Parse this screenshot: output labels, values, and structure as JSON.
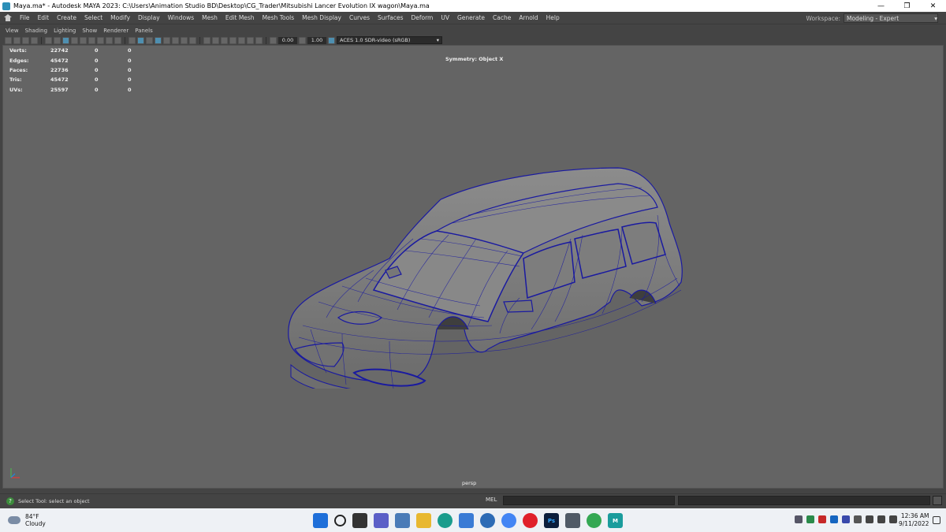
{
  "window": {
    "title": "Maya.ma* - Autodesk MAYA 2023: C:\\Users\\Animation Studio BD\\Desktop\\CG_Trader\\Mitsubishi Lancer Evolution IX wagon\\Maya.ma",
    "minimize": "—",
    "maximize": "❐",
    "close": "✕"
  },
  "menubar": {
    "items": [
      "File",
      "Edit",
      "Create",
      "Select",
      "Modify",
      "Display",
      "Windows",
      "Mesh",
      "Edit Mesh",
      "Mesh Tools",
      "Mesh Display",
      "Curves",
      "Surfaces",
      "Deform",
      "UV",
      "Generate",
      "Cache",
      "Arnold",
      "Help"
    ],
    "workspace_label": "Workspace:",
    "workspace_value": "Modeling - Expert"
  },
  "panel_menu": {
    "items": [
      "View",
      "Shading",
      "Lighting",
      "Show",
      "Renderer",
      "Panels"
    ]
  },
  "toolbar": {
    "field1": "0.00",
    "field2": "1.00",
    "colorspace": "ACES 1.0 SDR-video (sRGB)"
  },
  "hud": {
    "rows": [
      {
        "label": "Verts:",
        "v1": "22742",
        "v2": "0",
        "v3": "0"
      },
      {
        "label": "Edges:",
        "v1": "45472",
        "v2": "0",
        "v3": "0"
      },
      {
        "label": "Faces:",
        "v1": "22736",
        "v2": "0",
        "v3": "0"
      },
      {
        "label": "Tris:",
        "v1": "45472",
        "v2": "0",
        "v3": "0"
      },
      {
        "label": "UVs:",
        "v1": "25597",
        "v2": "0",
        "v3": "0"
      }
    ],
    "symmetry": "Symmetry: Object X",
    "camera": "persp"
  },
  "status": {
    "help_text": "Select Tool: select an object",
    "mel_label": "MEL"
  },
  "taskbar": {
    "temperature": "84°F",
    "condition": "Cloudy",
    "time": "12:36 AM",
    "date": "9/11/2022",
    "apps": [
      "windows-start",
      "search",
      "task-view",
      "chat",
      "photos",
      "file-explorer",
      "edge",
      "store",
      "settings",
      "chrome",
      "opera",
      "photoshop",
      "calculator",
      "chrome-2",
      "maya"
    ]
  },
  "colors": {
    "viewport_bg": "#646464",
    "wireframe": "#1a1aa0",
    "ui_bg": "#444444",
    "accent": "#4e8fb0"
  }
}
